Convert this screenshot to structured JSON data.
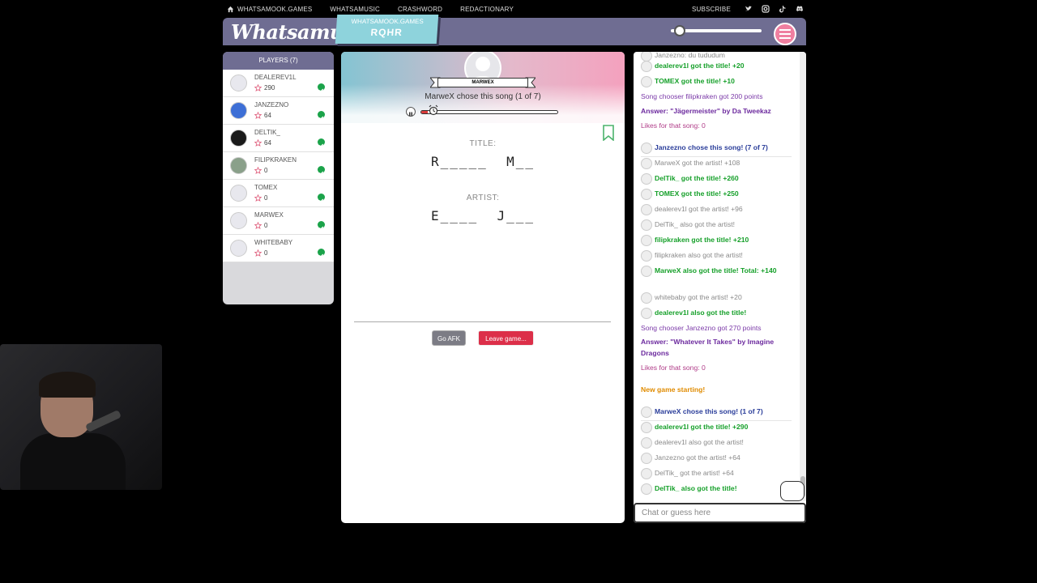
{
  "topnav": {
    "home": "WHATSAMOOK.GAMES",
    "links": [
      "WHATSAMUSIC",
      "CRASHWORD",
      "REDACTIONARY"
    ],
    "subscribe": "SUBSCRIBE",
    "socials": [
      "twitter-icon",
      "instagram-icon",
      "tiktok-icon",
      "discord-icon"
    ]
  },
  "header": {
    "logo": "Whatsamusic",
    "room_site": "WHATSAMOOK.GAMES",
    "room_code": "RQHR",
    "volume_level": 0.04
  },
  "players": {
    "title": "PLAYERS (7)",
    "list": [
      {
        "name": "DEALEREV1L",
        "score": "290"
      },
      {
        "name": "JANZEZNO",
        "score": "64"
      },
      {
        "name": "DELTIK_",
        "score": "64"
      },
      {
        "name": "FILIPKRAKEN",
        "score": "0"
      },
      {
        "name": "TOMEX",
        "score": "0"
      },
      {
        "name": "MARWEX",
        "score": "0"
      },
      {
        "name": "WHITEBABY",
        "score": "0"
      }
    ]
  },
  "game": {
    "chooser_name": "MARWEX",
    "chose_text": "MarweX chose this song (1 of 7)",
    "progress": 0.05,
    "title_label": "TITLE:",
    "title_hint": "R_____  M__",
    "artist_label": "ARTIST:",
    "artist_hint": "E____  J___",
    "afk_button": "Go AFK",
    "leave_button": "Leave game..."
  },
  "chat": {
    "messages": [
      {
        "text": "Janzezno: du tududum",
        "style": "faint",
        "avatar": true
      },
      {
        "text": "dealerev1l got the title! +20",
        "style": "green",
        "avatar": true
      },
      {
        "text": "TOMEX got the title! +10",
        "style": "green",
        "avatar": true
      },
      {
        "text": "Song chooser filipkraken got 200 points",
        "style": "purple",
        "avatar": false
      },
      {
        "text": "Answer: \"Jägermeister\" by Da Tweekaz",
        "style": "purplebold",
        "avatar": false
      },
      {
        "text": "Likes for that song: 0",
        "style": "pink",
        "avatar": false
      },
      {
        "text": "Janzezno chose this song! (7 of 7)",
        "style": "navy",
        "avatar": true
      },
      {
        "text": "MarweX got the artist! +108",
        "style": "faint",
        "avatar": true
      },
      {
        "text": "DelTik_ got the title! +260",
        "style": "green",
        "avatar": true
      },
      {
        "text": "TOMEX got the title! +250",
        "style": "green",
        "avatar": true
      },
      {
        "text": "dealerev1l got the artist! +96",
        "style": "faint",
        "avatar": true
      },
      {
        "text": "DelTik_ also got the artist!",
        "style": "faint",
        "avatar": true
      },
      {
        "text": "filipkraken got the title! +210",
        "style": "green",
        "avatar": true
      },
      {
        "text": "filipkraken also got the artist!",
        "style": "faint",
        "avatar": true
      },
      {
        "text": "MarweX also got the title! Total: +140",
        "style": "green",
        "avatar": true
      },
      {
        "text": "whitebaby got the artist! +20",
        "style": "faint",
        "avatar": true
      },
      {
        "text": "dealerev1l also got the title!",
        "style": "green",
        "avatar": true
      },
      {
        "text": "Song chooser Janzezno got 270 points",
        "style": "purple",
        "avatar": false
      },
      {
        "text": "Answer: \"Whatever It Takes\" by Imagine Dragons",
        "style": "purplebold",
        "avatar": false
      },
      {
        "text": "Likes for that song: 0",
        "style": "pink",
        "avatar": false
      },
      {
        "text": "New game starting!",
        "style": "orange",
        "avatar": false
      },
      {
        "text": "MarweX chose this song! (1 of 7)",
        "style": "navy",
        "avatar": true
      },
      {
        "text": "dealerev1l got the title! +290",
        "style": "green",
        "avatar": true
      },
      {
        "text": "dealerev1l also got the artist!",
        "style": "faint",
        "avatar": true
      },
      {
        "text": "Janzezno got the artist! +64",
        "style": "faint",
        "avatar": true
      },
      {
        "text": "DelTik_ got the artist! +64",
        "style": "faint",
        "avatar": true
      },
      {
        "text": "DelTik_ also got the title!",
        "style": "green",
        "avatar": true
      }
    ],
    "input_placeholder": "Chat or guess here"
  },
  "colors": {
    "header": "#6f6d92",
    "green": "#16a02a",
    "leave": "#dc2f49",
    "accent_pink": "#ef7fa0"
  }
}
